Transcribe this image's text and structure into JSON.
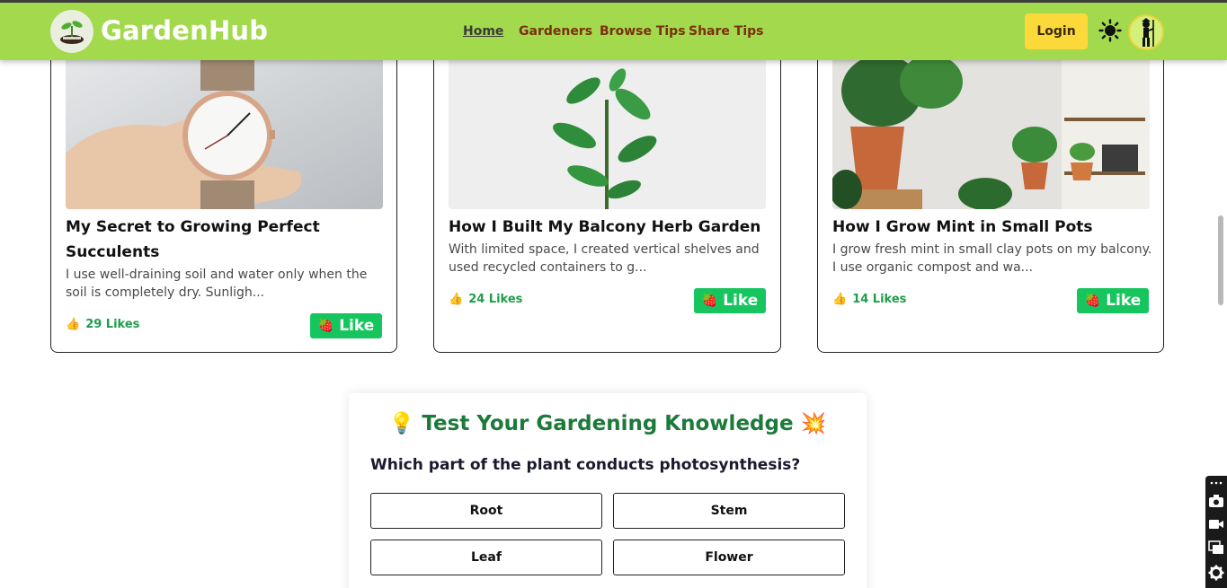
{
  "header": {
    "brand": "GardenHub",
    "nav": [
      "Home",
      "Gardeners",
      "Browse Tips",
      "Share Tips"
    ],
    "login_label": "Login",
    "colors": {
      "navbar": "#a3d94c",
      "login": "#fcd93a",
      "nav_link": "#7a2e0e"
    }
  },
  "cards": [
    {
      "title": "My Secret to Growing Perfect Succulents",
      "description": "I use well-draining soil and water only when the soil is completely dry. Sunligh...",
      "likes": "29 Likes",
      "like_label": "Like"
    },
    {
      "title": "How I Built My Balcony Herb Garden",
      "description": "With limited space, I created vertical shelves and used recycled containers to g...",
      "likes": "24 Likes",
      "like_label": "Like"
    },
    {
      "title": "How I Grow Mint in Small Pots",
      "description": "I grow fresh mint in small clay pots on my balcony. I use organic compost and wa...",
      "likes": "14 Likes",
      "like_label": "Like"
    }
  ],
  "quiz": {
    "title": "Test Your Gardening Knowledge",
    "question": "Which part of the plant conducts photosynthesis?",
    "options": [
      "Root",
      "Stem",
      "Leaf",
      "Flower"
    ]
  }
}
